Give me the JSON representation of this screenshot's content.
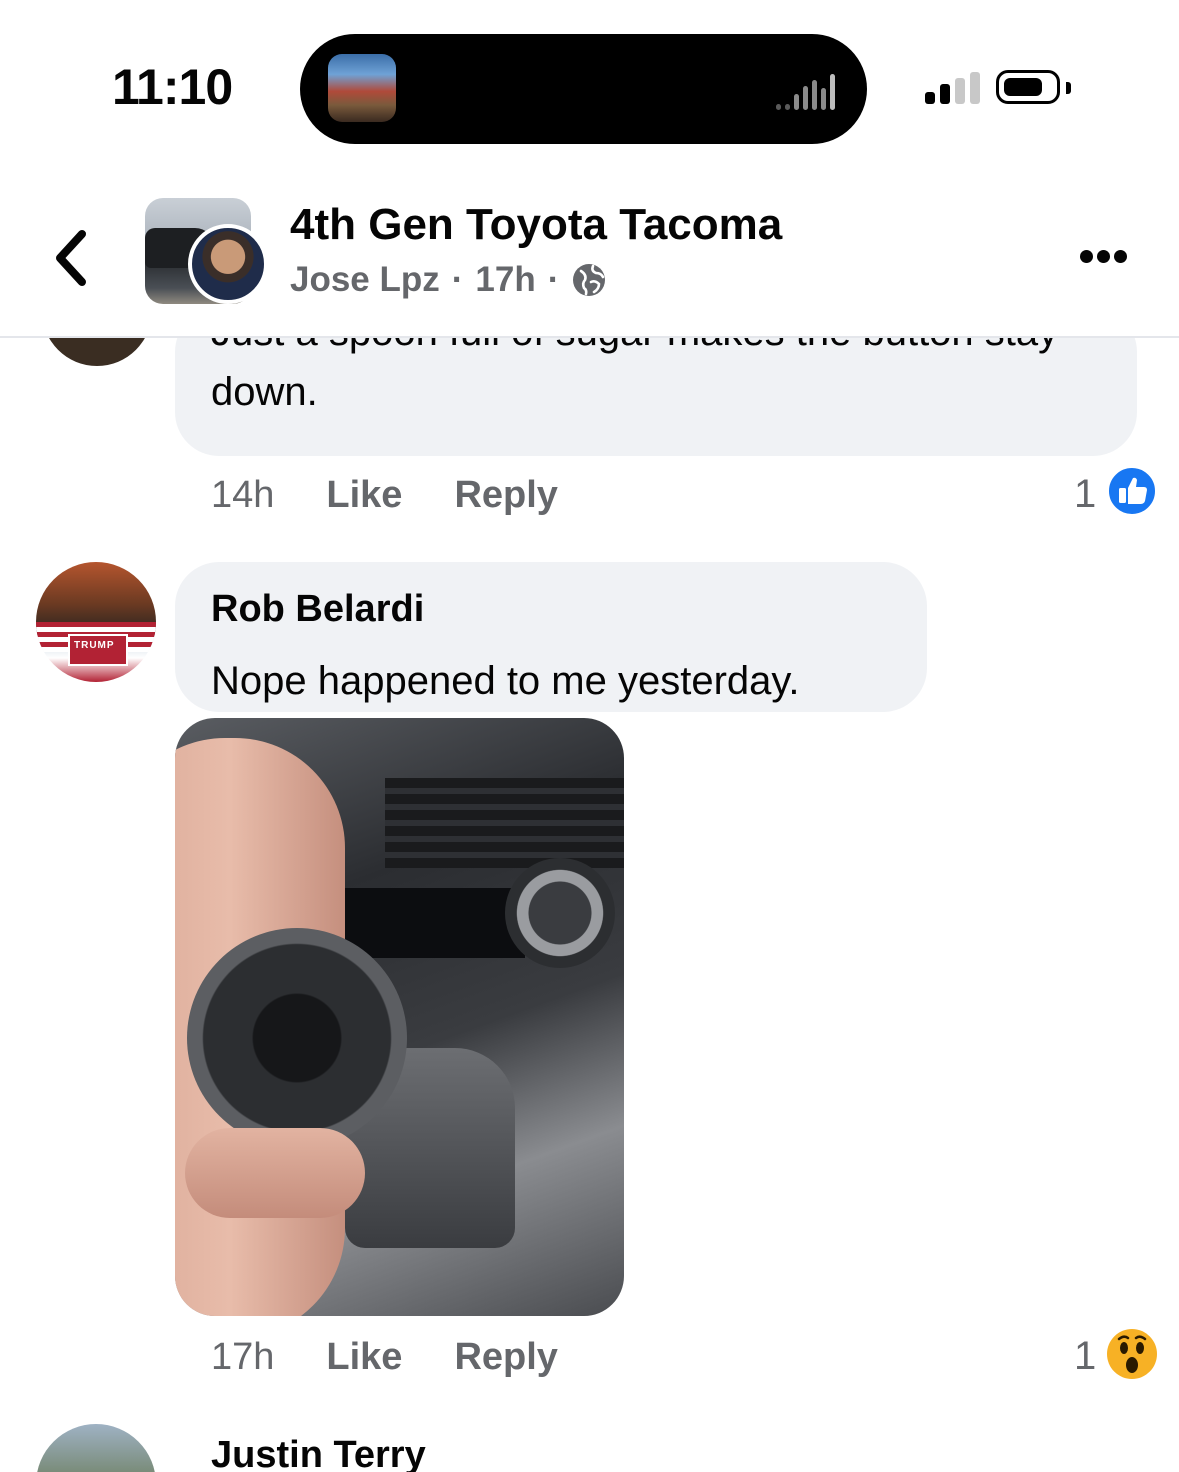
{
  "status_bar": {
    "time": "11:10"
  },
  "header": {
    "group_name": "4th Gen Toyota Tacoma",
    "author": "Jose Lpz",
    "separator": "·",
    "post_age": "17h",
    "separator2": "·"
  },
  "comments": [
    {
      "text": "Just a spoon full of sugar makes the button stay down.",
      "time": "14h",
      "like_label": "Like",
      "reply_label": "Reply",
      "reaction_count": "1",
      "reaction_icon": "like-icon",
      "reaction_color": "#1877f2"
    },
    {
      "author": "Rob Belardi",
      "text": "Nope happened to me yesterday.",
      "time": "17h",
      "like_label": "Like",
      "reply_label": "Reply",
      "reaction_count": "1",
      "reaction_icon": "wow-icon",
      "reaction_color": "#f7b125",
      "avatar_sign_text": "TRUMP"
    },
    {
      "author": "Justin Terry"
    }
  ]
}
